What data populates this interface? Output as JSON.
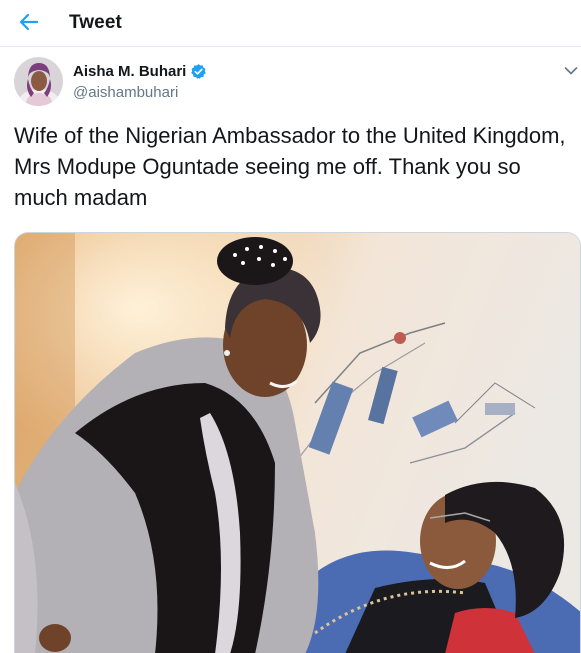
{
  "header": {
    "title": "Tweet"
  },
  "tweet": {
    "author": {
      "display_name": "Aisha M. Buhari",
      "handle": "@aishambuhari",
      "verified": true
    },
    "text": "Wife of the Nigerian Ambassador to the United Kingdom, Mrs Modupe Oguntade seeing me off. Thank you so much madam"
  },
  "colors": {
    "accent": "#1da1f2",
    "text": "#14171a",
    "secondary": "#657786",
    "border": "#e6ecf0"
  },
  "icons": {
    "back": "back-arrow-icon",
    "verified": "verified-badge-icon",
    "more": "chevron-down-icon"
  }
}
